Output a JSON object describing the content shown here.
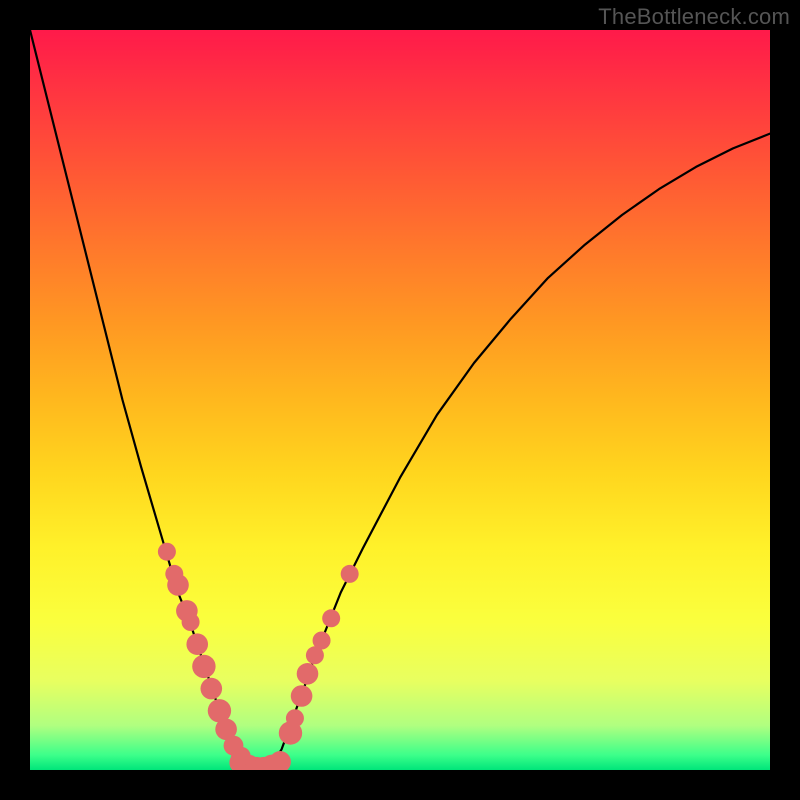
{
  "brand": {
    "label": "TheBottleneck.com"
  },
  "colors": {
    "frame": "#000000",
    "curve": "#000000",
    "dot_fill": "#e26a6a",
    "dot_stroke": "#c94f4f"
  },
  "chart_data": {
    "type": "line",
    "title": "",
    "xlabel": "",
    "ylabel": "",
    "xlim": [
      0,
      1
    ],
    "ylim": [
      0,
      100
    ],
    "grid": false,
    "legend": false,
    "x": [
      0.0,
      0.025,
      0.05,
      0.075,
      0.1,
      0.125,
      0.15,
      0.175,
      0.2,
      0.21,
      0.22,
      0.23,
      0.24,
      0.25,
      0.26,
      0.27,
      0.28,
      0.29,
      0.3,
      0.31,
      0.32,
      0.33,
      0.34,
      0.35,
      0.36,
      0.37,
      0.38,
      0.4,
      0.42,
      0.45,
      0.5,
      0.55,
      0.6,
      0.65,
      0.7,
      0.75,
      0.8,
      0.85,
      0.9,
      0.95,
      1.0
    ],
    "y": [
      100.0,
      90.0,
      80.0,
      70.0,
      60.0,
      50.0,
      41.0,
      32.5,
      24.0,
      21.5,
      18.8,
      15.8,
      12.8,
      9.8,
      7.0,
      4.5,
      2.5,
      1.0,
      0.2,
      0.0,
      0.2,
      1.2,
      2.8,
      5.5,
      8.3,
      11.0,
      14.0,
      19.0,
      24.0,
      30.0,
      39.5,
      48.0,
      55.0,
      61.0,
      66.5,
      71.0,
      75.0,
      78.5,
      81.5,
      84.0,
      86.0
    ],
    "curve_minimum": {
      "x": 0.31,
      "y": 0.0
    },
    "dots_left_branch": [
      {
        "x": 0.185,
        "y": 29.5,
        "r": 1.0
      },
      {
        "x": 0.195,
        "y": 26.5,
        "r": 1.0
      },
      {
        "x": 0.2,
        "y": 25.0,
        "r": 1.2
      },
      {
        "x": 0.212,
        "y": 21.5,
        "r": 1.2
      },
      {
        "x": 0.217,
        "y": 20.0,
        "r": 1.0
      },
      {
        "x": 0.226,
        "y": 17.0,
        "r": 1.2
      },
      {
        "x": 0.235,
        "y": 14.0,
        "r": 1.3
      },
      {
        "x": 0.245,
        "y": 11.0,
        "r": 1.2
      },
      {
        "x": 0.256,
        "y": 8.0,
        "r": 1.3
      },
      {
        "x": 0.265,
        "y": 5.5,
        "r": 1.2
      },
      {
        "x": 0.275,
        "y": 3.3,
        "r": 1.1
      },
      {
        "x": 0.285,
        "y": 1.8,
        "r": 1.1
      }
    ],
    "dots_bottom": [
      {
        "x": 0.284,
        "y": 1.0,
        "r": 1.2
      },
      {
        "x": 0.295,
        "y": 0.5,
        "r": 1.3
      },
      {
        "x": 0.306,
        "y": 0.2,
        "r": 1.3
      },
      {
        "x": 0.316,
        "y": 0.2,
        "r": 1.3
      },
      {
        "x": 0.327,
        "y": 0.5,
        "r": 1.3
      },
      {
        "x": 0.338,
        "y": 1.1,
        "r": 1.2
      }
    ],
    "dots_right_branch": [
      {
        "x": 0.352,
        "y": 5.0,
        "r": 1.3
      },
      {
        "x": 0.358,
        "y": 7.0,
        "r": 1.0
      },
      {
        "x": 0.367,
        "y": 10.0,
        "r": 1.2
      },
      {
        "x": 0.375,
        "y": 13.0,
        "r": 1.2
      },
      {
        "x": 0.385,
        "y": 15.5,
        "r": 1.0
      },
      {
        "x": 0.394,
        "y": 17.5,
        "r": 1.0
      },
      {
        "x": 0.407,
        "y": 20.5,
        "r": 1.0
      },
      {
        "x": 0.432,
        "y": 26.5,
        "r": 1.0
      }
    ]
  }
}
